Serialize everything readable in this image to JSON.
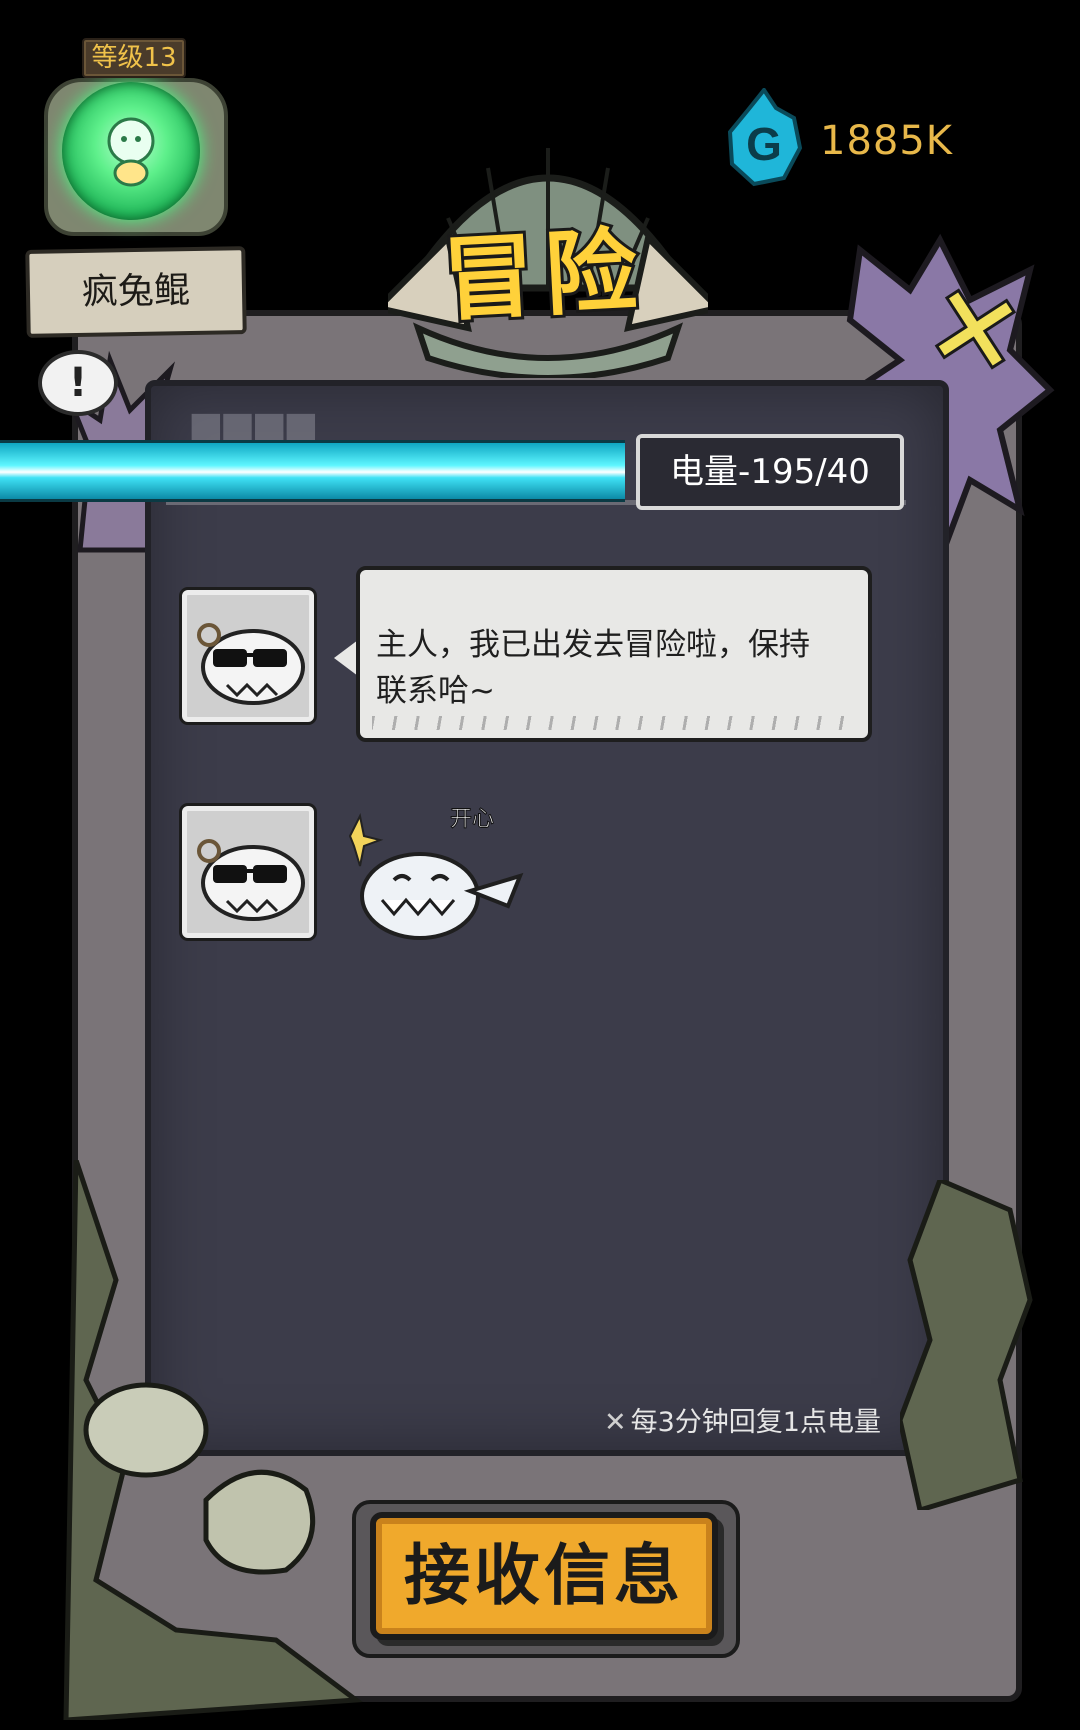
{
  "profile": {
    "level_label": "等级13",
    "name": "疯兔鲲",
    "alert_symbol": "!"
  },
  "currency": {
    "icon": "g-gem-icon",
    "value": "1885K"
  },
  "header": {
    "title": "冒险",
    "close_symbol": "✕"
  },
  "energy": {
    "label": "电量-195/40",
    "fill_fraction": 1.0
  },
  "messages": [
    {
      "type": "text",
      "avatar": "sunglasses-fish-avatar",
      "text": "主人，我已出发去冒险啦，保持联系哈~"
    },
    {
      "type": "sticker",
      "avatar": "sunglasses-fish-avatar",
      "sticker": "happy-fish-sticker",
      "sticker_caption": "开心"
    }
  ],
  "footer": {
    "hint": "每3分钟回复1点电量",
    "receive_button": "接收信息"
  },
  "colors": {
    "accent_yellow": "#ffd13a",
    "energy_cyan": "#3fe2f5",
    "currency_gold": "#e8b84a",
    "button_orange": "#f0a92c",
    "panel": "#3c3c4a"
  }
}
